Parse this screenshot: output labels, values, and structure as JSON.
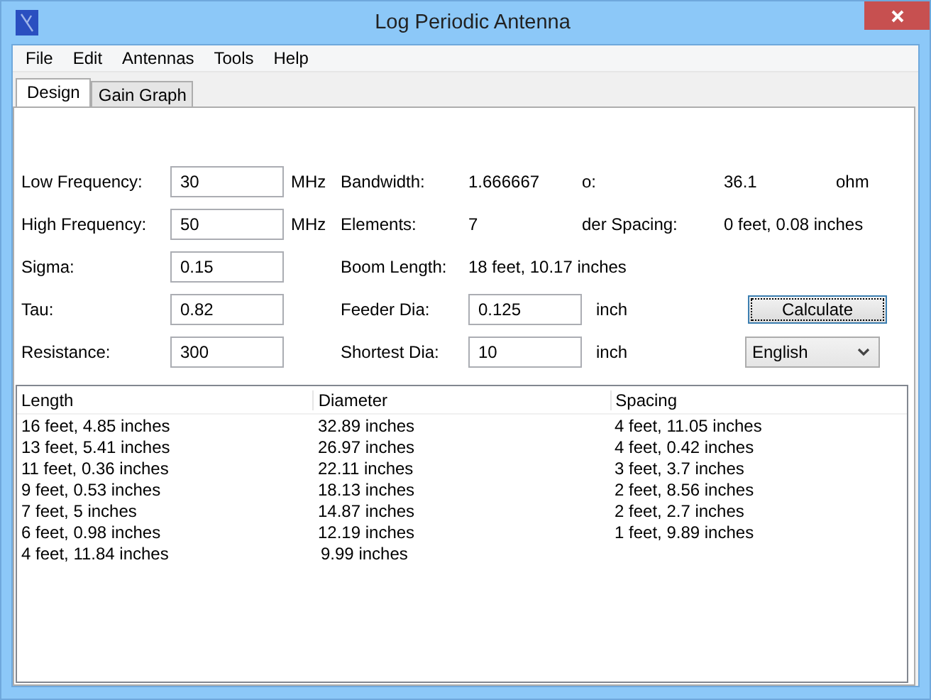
{
  "window": {
    "title": "Log Periodic Antenna"
  },
  "menu": [
    "File",
    "Edit",
    "Antennas",
    "Tools",
    "Help"
  ],
  "tabs": [
    {
      "label": "Design",
      "selected": true
    },
    {
      "label": "Gain Graph",
      "selected": false
    }
  ],
  "form": [
    {
      "left": {
        "label": "Low Frequency:",
        "value": "30",
        "unit": "MHz"
      },
      "middle": {
        "kind": "readout",
        "label": "Bandwidth:",
        "value": "1.666667"
      },
      "right": {
        "kind": "readout",
        "label": "o:",
        "value": "36.1",
        "unit": "ohm"
      }
    },
    {
      "left": {
        "label": "High Frequency:",
        "value": "50",
        "unit": "MHz"
      },
      "middle": {
        "kind": "readout",
        "label": "Elements:",
        "value": "7"
      },
      "right": {
        "kind": "readout",
        "label": "der Spacing:",
        "value": "0 feet, 0.08 inches"
      }
    },
    {
      "left": {
        "label": "Sigma:",
        "value": "0.15"
      },
      "middle": {
        "kind": "readout",
        "label": "Boom Length:",
        "value": "18 feet, 10.17 inches"
      }
    },
    {
      "left": {
        "label": "Tau:",
        "value": "0.82"
      },
      "middle": {
        "kind": "input",
        "label": "Feeder Dia:",
        "value": "0.125",
        "unit": "inch"
      },
      "right": {
        "kind": "button",
        "label": "Calculate"
      }
    },
    {
      "left": {
        "label": "Resistance:",
        "value": "300"
      },
      "middle": {
        "kind": "input",
        "label": "Shortest Dia:",
        "value": "10",
        "unit": "inch"
      },
      "right": {
        "kind": "select",
        "value": "English"
      }
    }
  ],
  "table": {
    "columns": [
      "Length",
      "Diameter",
      "Spacing"
    ],
    "rows": [
      [
        "16 feet, 4.85 inches",
        "32.89 inches",
        "4 feet, 11.05 inches"
      ],
      [
        "13 feet, 5.41 inches",
        "26.97 inches",
        "4 feet, 0.42 inches"
      ],
      [
        "11 feet, 0.36 inches",
        "22.11 inches",
        "3 feet, 3.7 inches"
      ],
      [
        "9 feet, 0.53 inches",
        "18.13 inches",
        "2 feet, 8.56 inches"
      ],
      [
        "7 feet, 5 inches",
        "14.87 inches",
        "2 feet, 2.7 inches"
      ],
      [
        "6 feet, 0.98 inches",
        "12.19 inches",
        "1 feet, 9.89 inches"
      ],
      [
        "4 feet, 11.84 inches",
        "9.99 inches"
      ]
    ]
  }
}
